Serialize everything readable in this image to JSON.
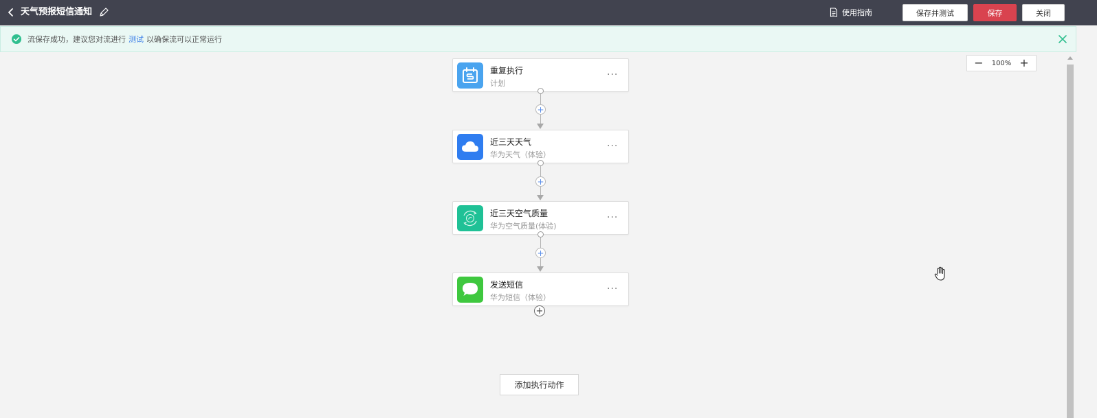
{
  "header": {
    "title": "天气预报短信通知",
    "guide_label": "使用指南",
    "save_test_label": "保存并测试",
    "save_label": "保存",
    "close_label": "关闭"
  },
  "banner": {
    "text_before": "流保存成功，建议您对流进行",
    "link_text": "测试",
    "text_after": "以确保流可以正常运行"
  },
  "zoom": {
    "level": "100%"
  },
  "steps": [
    {
      "title": "重复执行",
      "subtitle": "计划",
      "icon": "schedule-icon",
      "color": "#4aa4ef"
    },
    {
      "title": "近三天天气",
      "subtitle": "华为天气（体验）",
      "icon": "cloud-icon",
      "color": "#2f7df0"
    },
    {
      "title": "近三天空气质量",
      "subtitle": "华为空气质量(体验)",
      "icon": "air-quality-icon",
      "color": "#1fc196"
    },
    {
      "title": "发送短信",
      "subtitle": "华为短信（体验）",
      "icon": "message-icon",
      "color": "#3fc83f"
    }
  ],
  "add_action_label": "添加执行动作",
  "colors": {
    "topbar": "#41434f",
    "save_button": "#d9434f",
    "link": "#3b7ee8",
    "success": "#2fbf8f"
  }
}
